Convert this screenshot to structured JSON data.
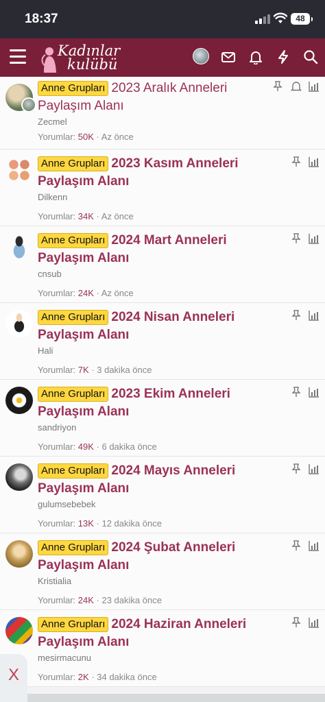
{
  "status_bar": {
    "time": "18:37",
    "battery": "48"
  },
  "header": {
    "logo_line1": "Kadınlar",
    "logo_line2": "kulübü"
  },
  "threads": [
    {
      "badge": "Anne Grupları",
      "title": "2023 Aralık Anneleri Paylaşım Alanı",
      "author": "Zecmel",
      "replies_label": "Yorumlar:",
      "replies": "50K",
      "time": "· Az önce"
    },
    {
      "badge": "Anne Grupları",
      "title": "2023 Kasım Anneleri Paylaşım Alanı",
      "author": "Dilkenn",
      "replies_label": "Yorumlar:",
      "replies": "34K",
      "time": "· Az önce"
    },
    {
      "badge": "Anne Grupları",
      "title": "2024 Mart Anneleri Paylaşım Alanı",
      "author": "cnsub",
      "replies_label": "Yorumlar:",
      "replies": "24K",
      "time": "· Az önce"
    },
    {
      "badge": "Anne Grupları",
      "title": "2024 Nisan Anneleri Paylaşım Alanı",
      "author": "Hali",
      "replies_label": "Yorumlar:",
      "replies": "7K",
      "time": "· 3 dakika önce"
    },
    {
      "badge": "Anne Grupları",
      "title": "2023 Ekim Anneleri Paylaşım Alanı",
      "author": "sandriyon",
      "replies_label": "Yorumlar:",
      "replies": "49K",
      "time": "· 6 dakika önce"
    },
    {
      "badge": "Anne Grupları",
      "title": "2024 Mayıs Anneleri Paylaşım Alanı",
      "author": "gulumsebebek",
      "replies_label": "Yorumlar:",
      "replies": "13K",
      "time": "· 12 dakika önce"
    },
    {
      "badge": "Anne Grupları",
      "title": "2024 Şubat Anneleri Paylaşım Alanı",
      "author": "Kristialia",
      "replies_label": "Yorumlar:",
      "replies": "24K",
      "time": "· 23 dakika önce"
    },
    {
      "badge": "Anne Grupları",
      "title": "2024 Haziran Anneleri Paylaşım Alanı",
      "author": "mesirmacunu",
      "replies_label": "Yorumlar:",
      "replies": "2K",
      "time": "· 34 dakika önce"
    }
  ],
  "close_tab": {
    "label": "X"
  },
  "colors": {
    "brand": "#7a1f3a",
    "title": "#9b3158",
    "badge": "#ffd740"
  }
}
